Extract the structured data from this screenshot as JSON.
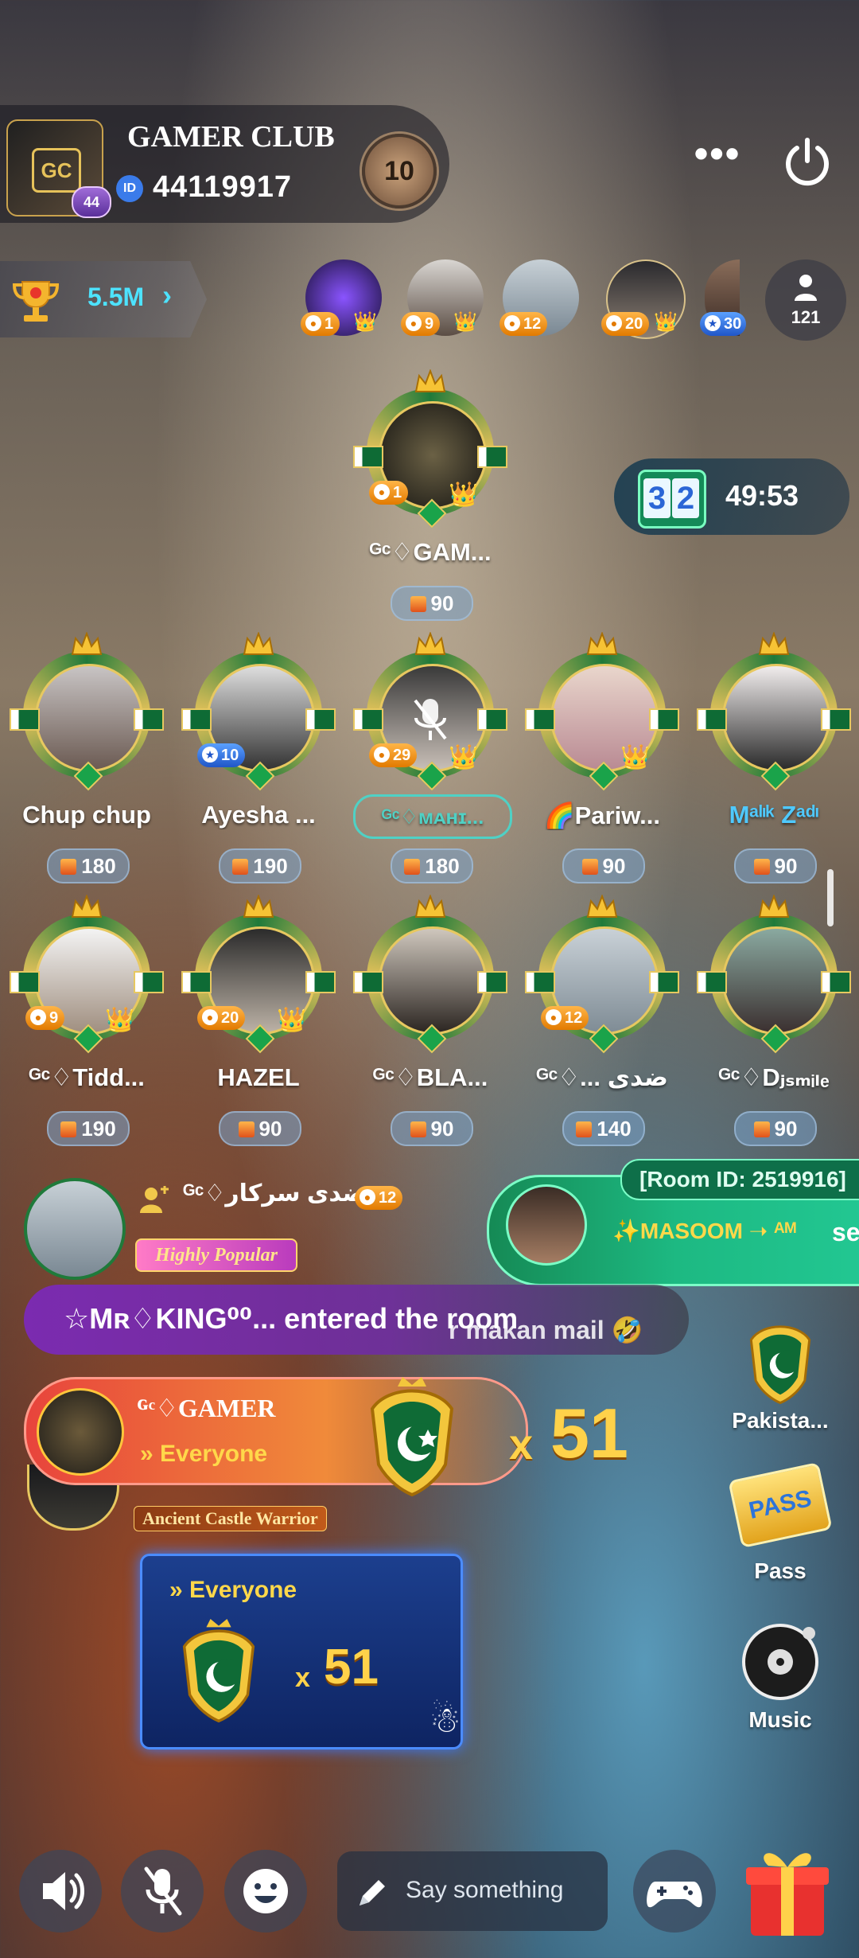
{
  "club": {
    "name": "GAMER CLUB",
    "id_badge": "ID",
    "id": "44119917",
    "avatar_level": "44",
    "level": "10"
  },
  "header": {
    "more_label": "•••"
  },
  "trophy": {
    "value": "5.5M",
    "chevron": "›"
  },
  "top_contributors": [
    {
      "badge": "1",
      "badge_color": "orange"
    },
    {
      "badge": "9",
      "badge_color": "orange"
    },
    {
      "badge": "12",
      "badge_color": "orange"
    },
    {
      "badge": "20",
      "badge_color": "orange"
    },
    {
      "badge": "30",
      "badge_color": "blue"
    }
  ],
  "online_count": "121",
  "host_seat": {
    "name": "ᴳᶜ♢GAM...",
    "level": "1",
    "gifts": "90"
  },
  "timer": {
    "digits": [
      "3",
      "2"
    ],
    "time": "49:53"
  },
  "seats_row1": [
    {
      "name": "Chup chup",
      "level": "",
      "gifts": "180",
      "muted": false
    },
    {
      "name": "Ayesha ...",
      "level": "10",
      "level_color": "blue",
      "gifts": "190",
      "muted": false
    },
    {
      "name": "ᴳᶜ♢ᴍᴀʜɪ...",
      "level": "29",
      "gifts": "180",
      "muted": true
    },
    {
      "name": "🌈Pariw...",
      "level": "",
      "gifts": "90",
      "muted": false
    },
    {
      "name": "Mᵃˡᶦᵏ Zᵃᵈᶦ",
      "level": "",
      "gifts": "90",
      "muted": false
    }
  ],
  "seats_row2": [
    {
      "name": "ᴳᶜ♢Tidd...",
      "level": "9",
      "gifts": "190"
    },
    {
      "name": "HAZEL",
      "level": "20",
      "gifts": "90"
    },
    {
      "name": "ᴳᶜ♢BLA...",
      "level": "",
      "gifts": "90"
    },
    {
      "name": "ᴳᶜ♢... ضدی",
      "level": "12",
      "gifts": "140"
    },
    {
      "name": "ᴳᶜ♢Dⱼₛₘᵢₗₑ",
      "level": "",
      "gifts": "90"
    }
  ],
  "chat": {
    "user_name": "ᴳᶜ♢ضدی سرکار",
    "user_level": "12",
    "user_tag": "Highly Popular",
    "entered_text": "☆Mʀ♢KING⁰⁰... entered the room",
    "entered_tail": "r makan mail 🤣"
  },
  "room_banner": {
    "room_id": "[Room ID: 2519916]",
    "text": "✨MASOOM ➝ ᴬᴹ",
    "tail": "se"
  },
  "gift_banner": {
    "sender": "ᴳᶜ♢GAMER",
    "to": "» Everyone",
    "x": "x",
    "count": "51",
    "title_tag": "Ancient Castle Warrior"
  },
  "gift_card": {
    "to": "» Everyone",
    "x": "x",
    "count": "51"
  },
  "side_actions": {
    "pakistan": "Pakista...",
    "pass": "Pass",
    "pass_badge": "PASS",
    "music": "Music"
  },
  "input": {
    "placeholder": "Say something"
  },
  "colors": {
    "accent_cyan": "#4de3ff",
    "gold": "#ffd24a",
    "green_room": "#1db982",
    "purple_entry": "#7b2bb0"
  }
}
